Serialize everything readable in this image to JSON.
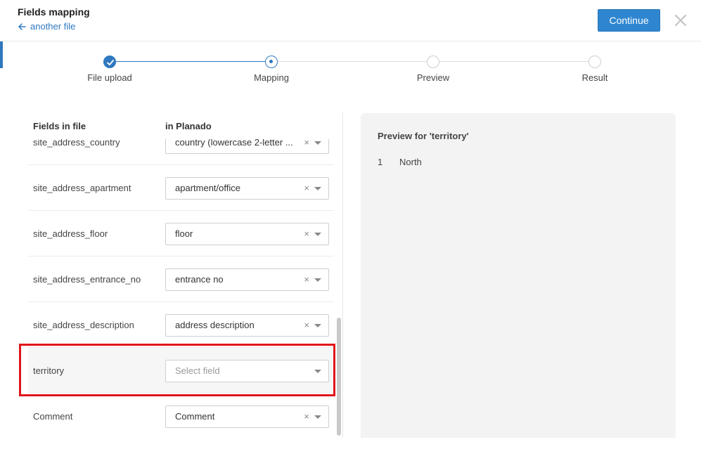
{
  "header": {
    "title": "Fields mapping",
    "back_label": "another file",
    "continue_label": "Continue",
    "close_icon": "close-icon",
    "back_icon": "arrow-left-icon"
  },
  "stepper": {
    "steps": [
      {
        "label": "File upload",
        "state": "done"
      },
      {
        "label": "Mapping",
        "state": "active"
      },
      {
        "label": "Preview",
        "state": "todo"
      },
      {
        "label": "Result",
        "state": "todo"
      }
    ]
  },
  "mapping": {
    "col_left": "Fields in file",
    "col_right": "in Planado",
    "rows": [
      {
        "field": "site_address_country",
        "value": "country (lowercase 2-letter ...",
        "placeholder": ""
      },
      {
        "field": "site_address_apartment",
        "value": "apartment/office",
        "placeholder": ""
      },
      {
        "field": "site_address_floor",
        "value": "floor",
        "placeholder": ""
      },
      {
        "field": "site_address_entrance_no",
        "value": "entrance no",
        "placeholder": ""
      },
      {
        "field": "site_address_description",
        "value": "address description",
        "placeholder": ""
      },
      {
        "field": "territory",
        "value": "",
        "placeholder": "Select field"
      },
      {
        "field": "Comment",
        "value": "Comment",
        "placeholder": ""
      }
    ],
    "clear_glyph": "×"
  },
  "preview": {
    "title": "Preview for 'territory'",
    "rows": [
      {
        "index": "1",
        "value": "North"
      }
    ]
  },
  "colors": {
    "accent": "#2f78c0",
    "highlight_border": "#e0141b"
  }
}
